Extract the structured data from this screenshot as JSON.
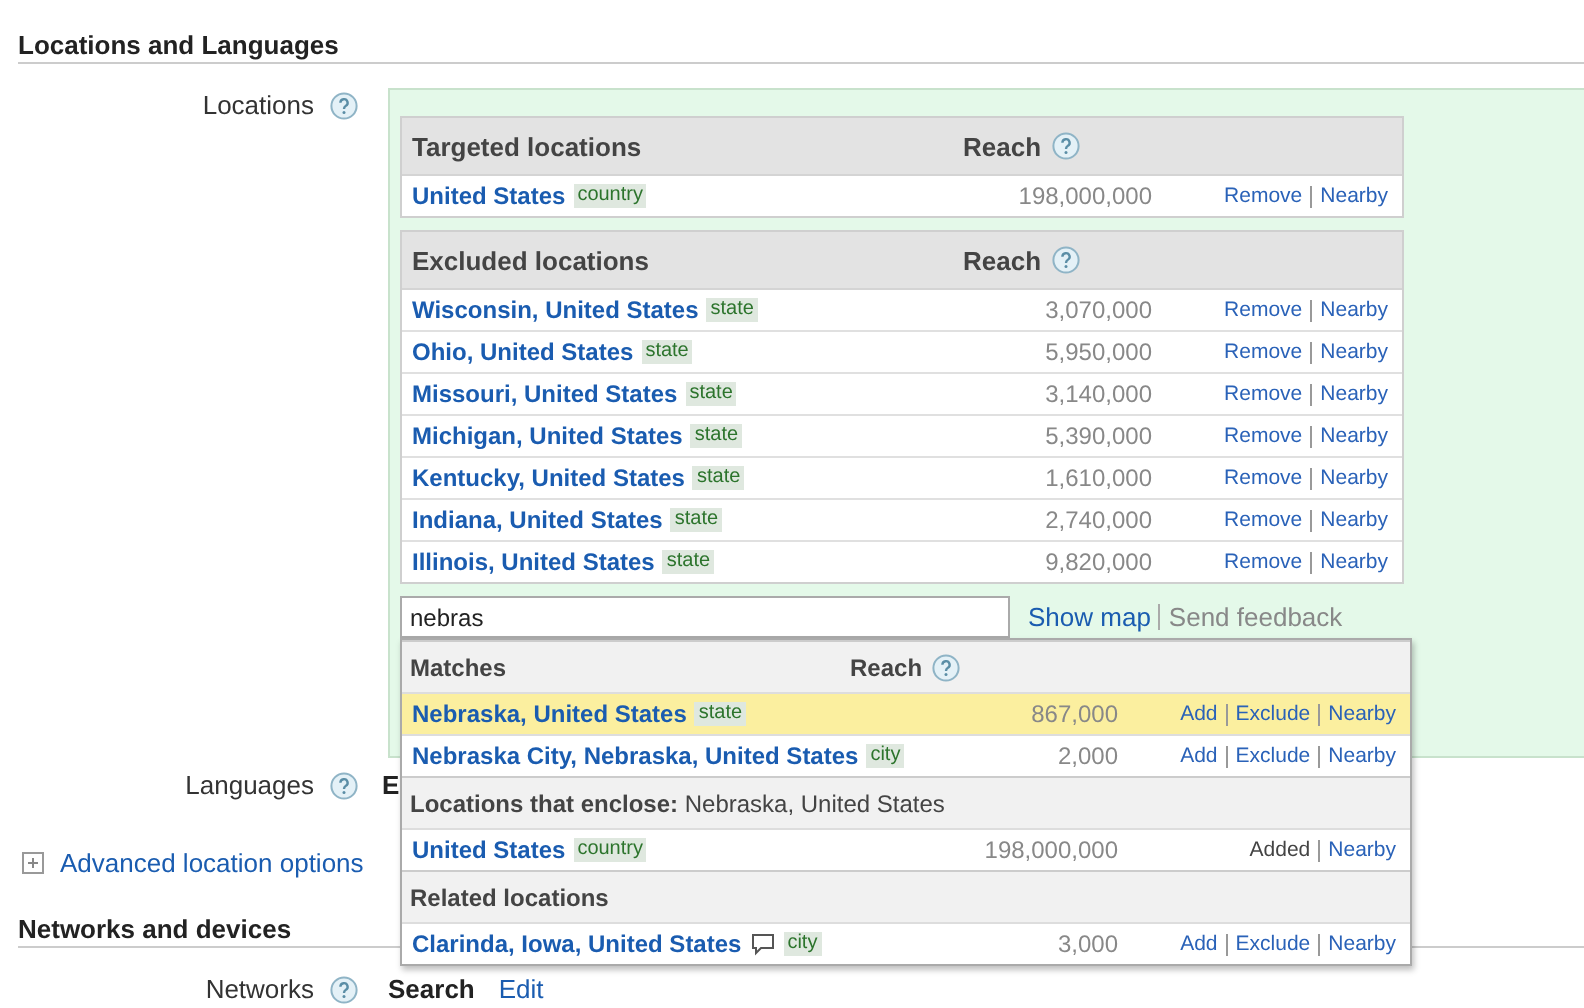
{
  "locations_section": {
    "heading": "Locations and Languages",
    "locations": {
      "label": "Locations",
      "targeted": {
        "columns": [
          "Targeted locations",
          "Reach"
        ],
        "rows": [
          {
            "name": "United States",
            "type": "country",
            "reach": "198,000,000",
            "actions": [
              "Remove",
              "Nearby"
            ]
          }
        ]
      },
      "excluded": {
        "columns": [
          "Excluded locations",
          "Reach"
        ],
        "rows": [
          {
            "name": "Wisconsin, United States",
            "type": "state",
            "reach": "3,070,000",
            "actions": [
              "Remove",
              "Nearby"
            ]
          },
          {
            "name": "Ohio, United States",
            "type": "state",
            "reach": "5,950,000",
            "actions": [
              "Remove",
              "Nearby"
            ]
          },
          {
            "name": "Missouri, United States",
            "type": "state",
            "reach": "3,140,000",
            "actions": [
              "Remove",
              "Nearby"
            ]
          },
          {
            "name": "Michigan, United States",
            "type": "state",
            "reach": "5,390,000",
            "actions": [
              "Remove",
              "Nearby"
            ]
          },
          {
            "name": "Kentucky, United States",
            "type": "state",
            "reach": "1,610,000",
            "actions": [
              "Remove",
              "Nearby"
            ]
          },
          {
            "name": "Indiana, United States",
            "type": "state",
            "reach": "2,740,000",
            "actions": [
              "Remove",
              "Nearby"
            ]
          },
          {
            "name": "Illinois, United States",
            "type": "state",
            "reach": "9,820,000",
            "actions": [
              "Remove",
              "Nearby"
            ]
          }
        ]
      },
      "search": {
        "value": "nebras"
      },
      "links": [
        {
          "text": "Show map",
          "disabled": false
        },
        {
          "text": "Send feedback",
          "disabled": true
        }
      ],
      "dropdown": {
        "groups": [
          {
            "heading": "Matches",
            "reach_heading": "Reach",
            "rows": [
              {
                "name": "Nebraska, United States",
                "type": "state",
                "note": false,
                "reach": "867,000",
                "selected": true,
                "actions": [
                  {
                    "text": "Add",
                    "kind": "link"
                  },
                  {
                    "text": "Exclude",
                    "kind": "link"
                  },
                  {
                    "text": "Nearby",
                    "kind": "link"
                  }
                ]
              },
              {
                "name": "Nebraska City, Nebraska, United States",
                "type": "city",
                "note": false,
                "reach": "2,000",
                "selected": false,
                "actions": [
                  {
                    "text": "Add",
                    "kind": "link"
                  },
                  {
                    "text": "Exclude",
                    "kind": "link"
                  },
                  {
                    "text": "Nearby",
                    "kind": "link"
                  }
                ]
              }
            ]
          },
          {
            "heading": "**Locations that enclose:** Nebraska, United States",
            "rows": [
              {
                "name": "United States",
                "type": "country",
                "note": false,
                "reach": "198,000,000",
                "selected": false,
                "actions": [
                  {
                    "text": "Added",
                    "kind": "status"
                  },
                  {
                    "text": "Nearby",
                    "kind": "link"
                  }
                ]
              }
            ]
          },
          {
            "heading": "Related locations",
            "rows": [
              {
                "name": "Clarinda, Iowa, United States",
                "type": "city",
                "note": true,
                "reach": "3,000",
                "selected": false,
                "actions": [
                  {
                    "text": "Add",
                    "kind": "link"
                  },
                  {
                    "text": "Exclude",
                    "kind": "link"
                  },
                  {
                    "text": "Nearby",
                    "kind": "link"
                  }
                ]
              }
            ]
          }
        ]
      }
    },
    "languages": {
      "label": "Languages",
      "value": "E"
    },
    "advanced_link": "Advanced location options"
  },
  "networks_section": {
    "heading": "Networks and devices",
    "networks": {
      "label": "Networks",
      "value": "Search",
      "edit": "Edit"
    }
  }
}
